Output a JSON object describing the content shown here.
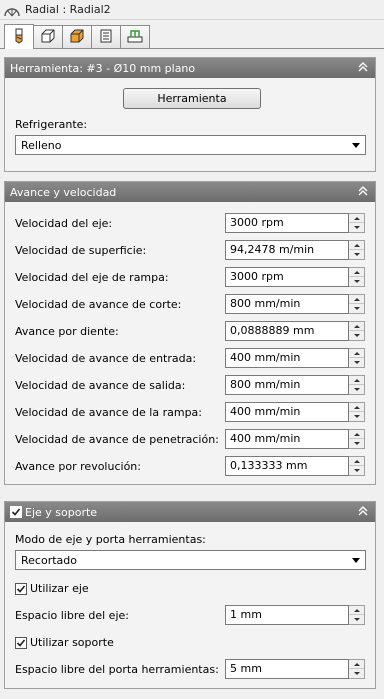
{
  "window": {
    "title": "Radial : Radial2",
    "title_icon": "radial-toolpath-icon"
  },
  "tabs": [
    {
      "icon": "tool-icon",
      "active": true
    },
    {
      "icon": "stock-box-icon",
      "active": false
    },
    {
      "icon": "geometry-icon",
      "active": false
    },
    {
      "icon": "passes-icon",
      "active": false
    },
    {
      "icon": "linking-icon",
      "active": false
    }
  ],
  "tool_panel": {
    "header": "Herramienta: #3 - Ø10 mm plano",
    "tool_button": "Herramienta",
    "coolant_label": "Refrigerante:",
    "coolant_value": "Relleno"
  },
  "feed_panel": {
    "header": "Avance y velocidad",
    "rows": [
      {
        "label": "Velocidad del eje:",
        "value": "3000 rpm"
      },
      {
        "label": "Velocidad de superficie:",
        "value": "94,2478 m/min"
      },
      {
        "label": "Velocidad del eje de rampa:",
        "value": "3000 rpm"
      },
      {
        "label": "Velocidad de avance de corte:",
        "value": "800 mm/min"
      },
      {
        "label": "Avance por diente:",
        "value": "0,0888889 mm"
      },
      {
        "label": "Velocidad de avance de entrada:",
        "value": "400 mm/min"
      },
      {
        "label": "Velocidad de avance de salida:",
        "value": "800 mm/min"
      },
      {
        "label": "Velocidad de avance de la rampa:",
        "value": "400 mm/min"
      },
      {
        "label": "Velocidad de avance de penetración:",
        "value": "400 mm/min"
      },
      {
        "label": "Avance por revolución:",
        "value": "0,133333 mm"
      }
    ]
  },
  "shaft_panel": {
    "header": "Eje y soporte",
    "header_checked": true,
    "mode_label": "Modo de eje y porta herramientas:",
    "mode_value": "Recortado",
    "use_shaft_label": "Utilizar eje",
    "use_shaft_checked": true,
    "shaft_clearance_label": "Espacio libre del eje:",
    "shaft_clearance_value": "1 mm",
    "use_holder_label": "Utilizar soporte",
    "use_holder_checked": true,
    "holder_clearance_label": "Espacio libre del porta herramientas:",
    "holder_clearance_value": "5 mm"
  },
  "colors": {
    "panel_header": "#7a7a7a",
    "tab_icon_accent": "#f0a030",
    "tab_icon_green": "#3a9a3a"
  }
}
